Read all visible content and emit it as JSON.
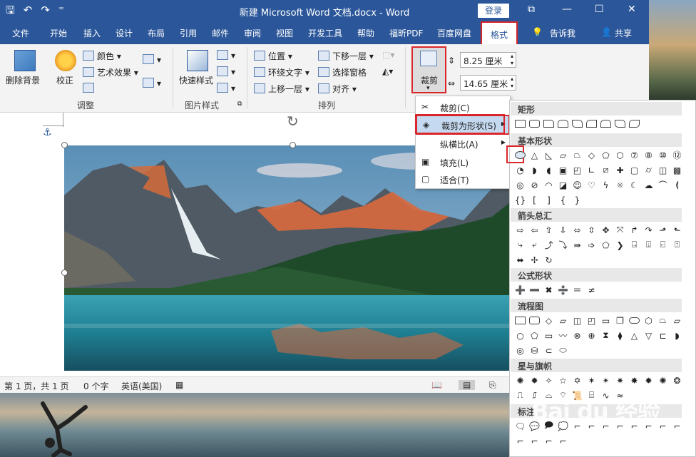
{
  "window": {
    "title": "新建 Microsoft Word 文档.docx  -  Word",
    "login_label": "登录",
    "controls": {
      "restore_ribbon": "⧉",
      "minimize": "—",
      "maximize": "☐",
      "close": "✕"
    }
  },
  "quick_access": {
    "save": "🖫",
    "undo": "↶",
    "redo": "↷",
    "customize": "⁼"
  },
  "tabs": [
    {
      "label": "文件"
    },
    {
      "label": "开始"
    },
    {
      "label": "插入"
    },
    {
      "label": "设计"
    },
    {
      "label": "布局"
    },
    {
      "label": "引用"
    },
    {
      "label": "邮件"
    },
    {
      "label": "审阅"
    },
    {
      "label": "视图"
    },
    {
      "label": "开发工具"
    },
    {
      "label": "帮助"
    },
    {
      "label": "福昕PDF"
    },
    {
      "label": "百度网盘"
    },
    {
      "label": "格式"
    }
  ],
  "tell_me": "告诉我",
  "share": "共享",
  "ribbon": {
    "remove_bg": "删除背景",
    "correct": "校正",
    "color": "颜色",
    "art_effect": "艺术效果",
    "adjust_group": "调整",
    "quick_style": "快速样式",
    "pic_style_group": "图片样式",
    "position": "位置",
    "wrap_text": "环绕文字",
    "bring_forward": "上移一层",
    "send_backward": "下移一层",
    "selection_pane": "选择窗格",
    "align": "对齐",
    "arrange_group": "排列",
    "crop": "裁剪",
    "height": "8.25 厘米",
    "width": "14.65 厘米"
  },
  "status": {
    "page": "第 1 页，共 1 页",
    "words": "0 个字",
    "lang": "英语(美国)"
  },
  "crop_menu": [
    {
      "label": "裁剪(C)"
    },
    {
      "label": "裁剪为形状(S)"
    },
    {
      "label": "纵横比(A)"
    },
    {
      "label": "填充(L)"
    },
    {
      "label": "适合(T)"
    }
  ],
  "shape_gallery": {
    "categories": [
      "矩形",
      "基本形状",
      "箭头总汇",
      "公式形状",
      "流程图",
      "星与旗帜",
      "标注"
    ]
  },
  "watermark": "Bai du 经验",
  "colors": {
    "word_blue": "#2b579a",
    "highlight_red": "#d9262b",
    "menu_hover": "#c5daf1"
  }
}
